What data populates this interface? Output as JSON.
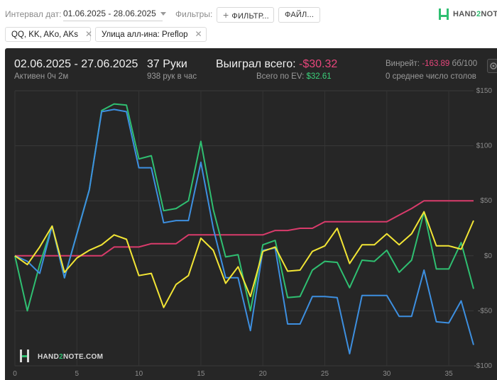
{
  "topbar": {
    "interval_label": "Интервал дат:",
    "interval_value": "01.06.2025 - 28.06.2025",
    "filters_label": "Фильтры:",
    "filter_button": "ФИЛЬТР...",
    "file_button": "ФАЙЛ...",
    "logo_pre": "HAND",
    "logo_two": "2",
    "logo_post": "NOTE."
  },
  "chips": [
    {
      "label": "QQ, KK, AKo, AKs"
    },
    {
      "label": "Улица алл-ина: Preflop"
    }
  ],
  "summary": {
    "date_range": "02.06.2025 - 27.06.2025",
    "active": "Активен 0ч 2м",
    "hands": "37 Руки",
    "hands_rate": "938 рук в час",
    "won_label": "Выиграл всего:",
    "won_value": "-$30.32",
    "ev_label": "Всего по EV:",
    "ev_value": "$32.61",
    "winrate_label": "Винрейт:",
    "winrate_value": "-163.89",
    "winrate_unit": "бб/100",
    "tables": "0 среднее число столов"
  },
  "watermark": {
    "pre": "HAND",
    "two": "2",
    "post": "NOTE.COM"
  },
  "colors": {
    "green": "#2fbf71",
    "blue": "#3d8fe0",
    "yellow": "#f2e535",
    "red": "#d93b6b"
  },
  "chart_data": {
    "type": "line",
    "x_ticks": [
      0,
      5,
      10,
      15,
      20,
      25,
      30,
      35
    ],
    "y_ticks": [
      "$150",
      "$100",
      "$50",
      "$0",
      "-$50",
      "-$100"
    ],
    "y_tick_values": [
      150,
      100,
      50,
      0,
      -50,
      -100
    ],
    "xlim": [
      0,
      37
    ],
    "ylim": [
      -100,
      150
    ],
    "grid": true,
    "series": [
      {
        "color": "#2fbf71",
        "values": [
          0,
          -50,
          -8,
          27,
          -20,
          20,
          60,
          132,
          138,
          137,
          88,
          91,
          41,
          43,
          50,
          104,
          42,
          -1,
          1,
          -50,
          10,
          14,
          -38,
          -37,
          -13,
          -5,
          -6,
          -29,
          -4,
          -5,
          5,
          -15,
          -4,
          40,
          -12,
          -12,
          12,
          -30
        ]
      },
      {
        "color": "#3d8fe0",
        "values": [
          0,
          -5,
          -16,
          27,
          -20,
          20,
          60,
          131,
          133,
          131,
          80,
          80,
          30,
          32,
          32,
          85,
          25,
          -20,
          -20,
          -68,
          5,
          7,
          -62,
          -62,
          -37,
          -37,
          -38,
          -89,
          -36,
          -36,
          -36,
          -55,
          -55,
          -13,
          -60,
          -61,
          -41,
          -81
        ]
      },
      {
        "color": "#f2e535",
        "values": [
          0,
          -8,
          8,
          27,
          -15,
          -2,
          5,
          10,
          19,
          15,
          -18,
          -16,
          -47,
          -26,
          -18,
          16,
          5,
          -25,
          -10,
          -37,
          4,
          8,
          -14,
          -13,
          4,
          9,
          25,
          -7,
          10,
          10,
          20,
          10,
          20,
          40,
          9,
          9,
          6,
          32
        ]
      },
      {
        "color": "#d93b6b",
        "values": [
          0,
          0,
          0,
          0,
          0,
          0,
          0,
          0,
          8,
          8,
          8,
          11,
          11,
          11,
          19,
          19,
          19,
          19,
          19,
          19,
          19,
          23,
          23,
          25,
          25,
          31,
          31,
          31,
          31,
          31,
          31,
          37,
          43,
          50,
          50,
          50,
          50,
          50
        ]
      }
    ]
  }
}
